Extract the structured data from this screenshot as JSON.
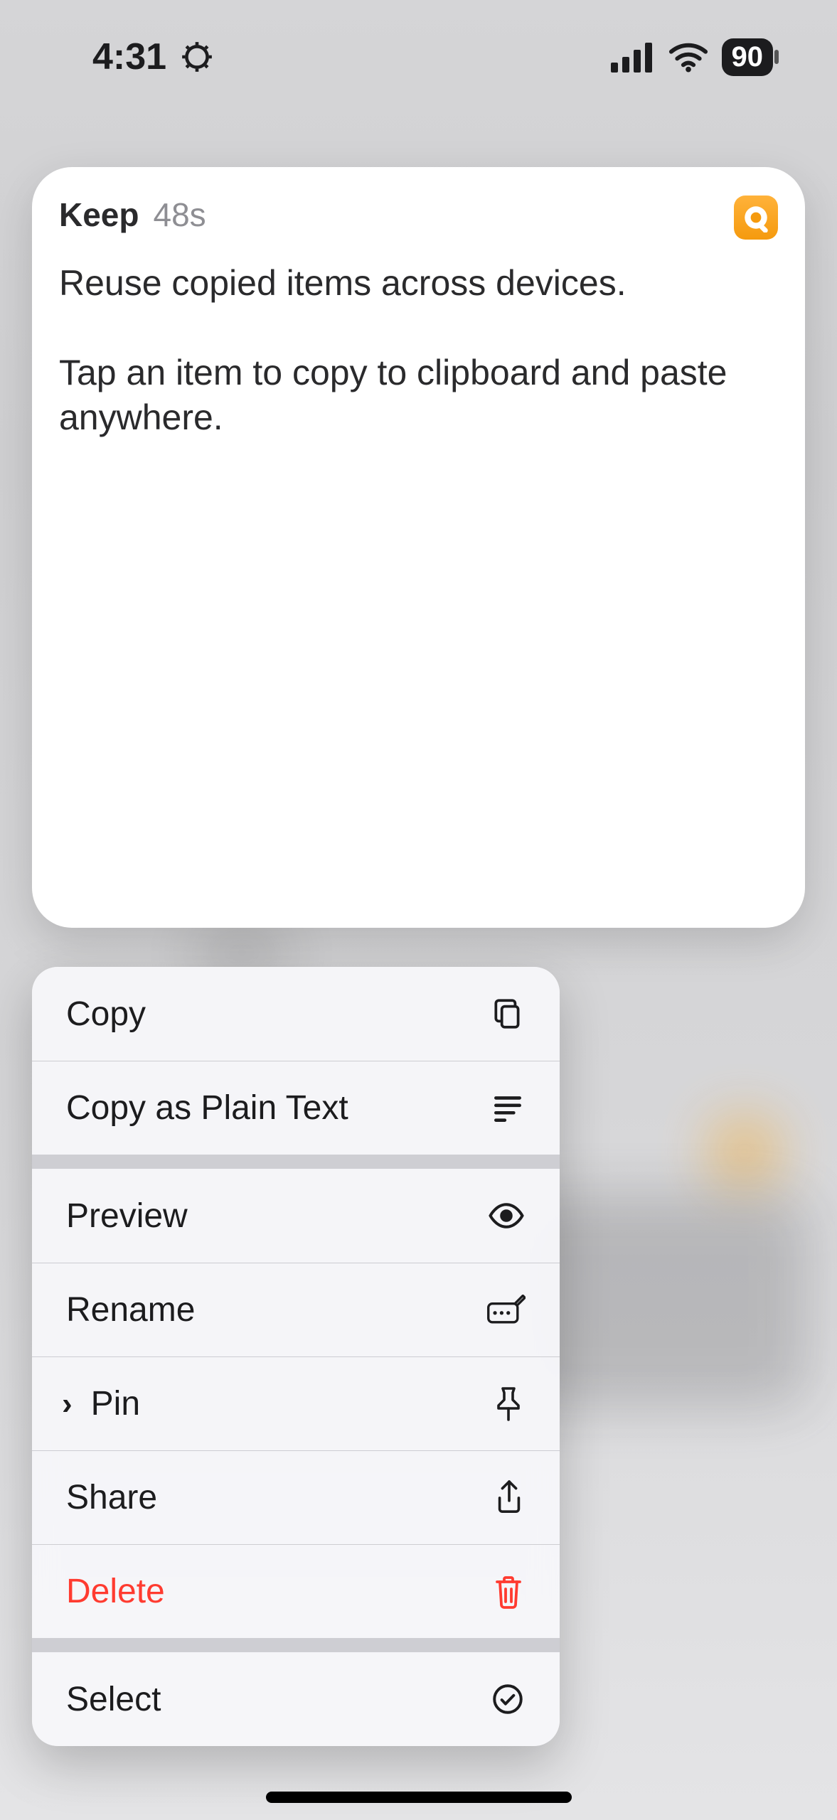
{
  "status_bar": {
    "time": "4:31",
    "battery_text": "90"
  },
  "card": {
    "source_app": "Keep",
    "age": "48s",
    "body": "Reuse copied items across devices.\n\nTap an item to copy to clipboard and paste anywhere."
  },
  "menu": {
    "copy": "Copy",
    "copy_plain": "Copy as Plain Text",
    "preview": "Preview",
    "rename": "Rename",
    "pin": "Pin",
    "share": "Share",
    "delete": "Delete",
    "select": "Select"
  }
}
